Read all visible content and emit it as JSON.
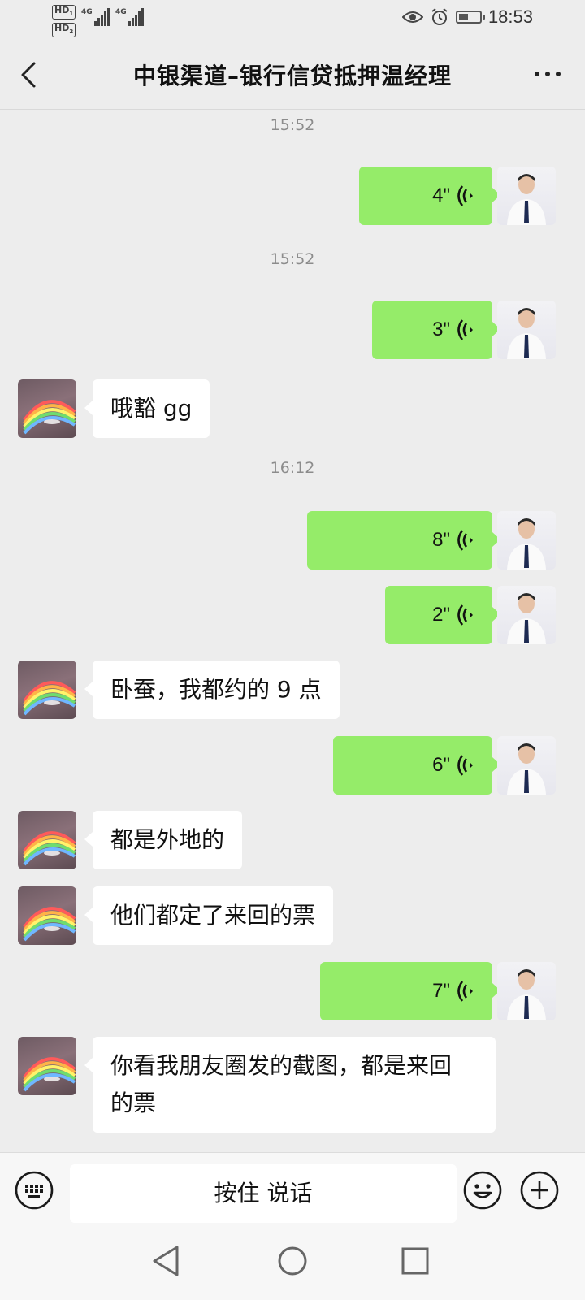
{
  "status_bar": {
    "sim1": "HD",
    "sim1_slot": "1",
    "sim2": "HD",
    "sim2_slot": "2",
    "network1": "4G",
    "network2": "4G",
    "time": "18:53",
    "icons": [
      "eye-icon",
      "alarm-icon",
      "battery-icon"
    ]
  },
  "header": {
    "title": "中银渠道–银行信贷抵押温经理",
    "back_icon": "chevron-left-icon",
    "more_icon": "more-dots-icon"
  },
  "messages": [
    {
      "type": "time",
      "text": "15:52"
    },
    {
      "type": "voice",
      "sender": "me",
      "duration": "4\""
    },
    {
      "type": "time",
      "text": "15:52"
    },
    {
      "type": "voice",
      "sender": "me",
      "duration": "3\""
    },
    {
      "type": "text",
      "sender": "them",
      "text": "哦豁 gg"
    },
    {
      "type": "time",
      "text": "16:12"
    },
    {
      "type": "voice",
      "sender": "me",
      "duration": "8\""
    },
    {
      "type": "voice",
      "sender": "me",
      "duration": "2\""
    },
    {
      "type": "text",
      "sender": "them",
      "text": "卧蚕，我都约的 9 点"
    },
    {
      "type": "voice",
      "sender": "me",
      "duration": "6\""
    },
    {
      "type": "text",
      "sender": "them",
      "text": "都是外地的"
    },
    {
      "type": "text",
      "sender": "them",
      "text": "他们都定了来回的票"
    },
    {
      "type": "voice",
      "sender": "me",
      "duration": "7\""
    },
    {
      "type": "text",
      "sender": "them",
      "text": "你看我朋友圈发的截图，都是来回\n的票"
    }
  ],
  "input_bar": {
    "hold_to_talk": "按住 说话",
    "keyboard_icon": "keyboard-icon",
    "emoji_icon": "emoji-icon",
    "plus_icon": "plus-icon"
  },
  "nav_bar": {
    "icons": [
      "nav-back-icon",
      "nav-home-icon",
      "nav-recents-icon"
    ]
  },
  "colors": {
    "background": "#ededed",
    "my_bubble": "#95ec69",
    "their_bubble": "#ffffff",
    "timestamp": "#8c8c8c"
  }
}
